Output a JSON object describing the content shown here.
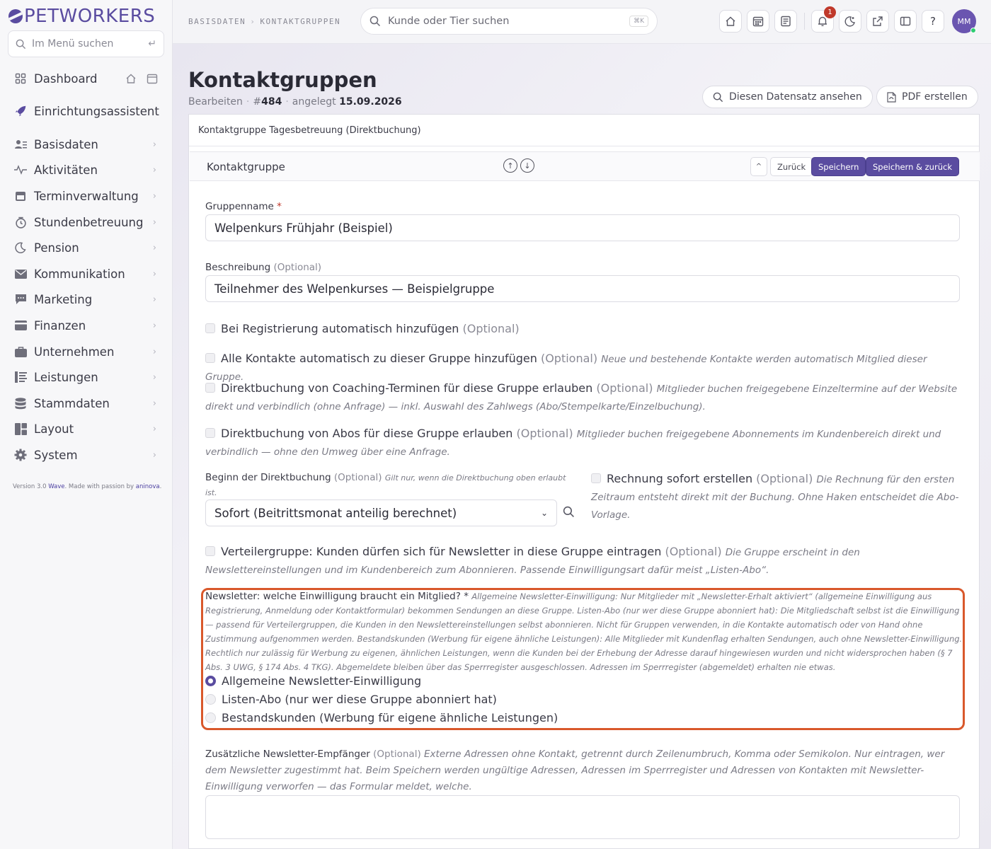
{
  "app": {
    "brand": "PETWORKERS"
  },
  "sidebar": {
    "search_placeholder": "Im Menü suchen",
    "items": [
      {
        "label": "Dashboard",
        "icon": "grid-icon"
      },
      {
        "label": "Einrichtungsassistent",
        "icon": "rocket-icon"
      },
      {
        "label": "Basisdaten",
        "icon": "contacts-icon"
      },
      {
        "label": "Aktivitäten",
        "icon": "activity-icon"
      },
      {
        "label": "Terminverwaltung",
        "icon": "calendar-icon"
      },
      {
        "label": "Stundenbetreuung",
        "icon": "clock-icon"
      },
      {
        "label": "Pension",
        "icon": "moon-icon"
      },
      {
        "label": "Kommunikation",
        "icon": "mail-icon"
      },
      {
        "label": "Marketing",
        "icon": "chat-icon"
      },
      {
        "label": "Finanzen",
        "icon": "card-icon"
      },
      {
        "label": "Unternehmen",
        "icon": "briefcase-icon"
      },
      {
        "label": "Leistungen",
        "icon": "list-icon"
      },
      {
        "label": "Stammdaten",
        "icon": "database-icon"
      },
      {
        "label": "Layout",
        "icon": "layout-icon"
      },
      {
        "label": "System",
        "icon": "gear-icon"
      }
    ],
    "version": {
      "prefix": "Version 3.0",
      "wave": "Wave",
      "middle": ". Made with passion by",
      "company": "aninova"
    }
  },
  "topbar": {
    "breadcrumb": [
      "BASISDATEN",
      "KONTAKTGRUPPEN"
    ],
    "search_placeholder": "Kunde oder Tier suchen",
    "search_shortcut": "⌘K",
    "notification_count": "1",
    "avatar_initials": "MM"
  },
  "page": {
    "title": "Kontaktgruppen",
    "mode": "Bearbeiten",
    "id_prefix": "#",
    "id": "484",
    "created_label": "angelegt",
    "created_date": "15.09.2026",
    "view_button": "Diesen Datensatz ansehen",
    "pdf_button": "PDF erstellen"
  },
  "card": {
    "title": "Kontaktgruppe Tagesbetreuung (Direktbuchung)",
    "section_title": "Kontaktgruppe",
    "btn_up": "^",
    "btn_back": "Zurück",
    "btn_save": "Speichern",
    "btn_save_back": "Speichern & zurück"
  },
  "form": {
    "optional": "(Optional)",
    "group_name_label": "Gruppenname",
    "required_mark": "*",
    "group_name_value": "Welpenkurs Frühjahr (Beispiel)",
    "description_label": "Beschreibung",
    "description_value": "Teilnehmer des Welpenkurses — Beispielgruppe",
    "cb1_label": "Bei Registrierung automatisch hinzufügen",
    "cb2_label": "Alle Kontakte automatisch zu dieser Gruppe hinzufügen",
    "cb2_hint": "Neue und bestehende Kontakte werden automatisch Mitglied dieser Gruppe.",
    "cb3_label": "Direktbuchung von Coaching-Terminen für diese Gruppe erlauben",
    "cb3_hint": "Mitglieder buchen freigegebene Einzeltermine auf der Website direkt und verbindlich (ohne Anfrage) — inkl. Auswahl des Zahlwegs (Abo/Stempelkarte/Einzelbuchung).",
    "cb4_label": "Direktbuchung von Abos für diese Gruppe erlauben",
    "cb4_hint": "Mitglieder buchen freigegebene Abonnements im Kundenbereich direkt und verbindlich — ohne den Umweg über eine Anfrage.",
    "start_label": "Beginn der Direktbuchung",
    "start_hint": "Gilt nur, wenn die Direktbuchung oben erlaubt ist.",
    "start_value": "Sofort (Beitrittsmonat anteilig berechnet)",
    "invoice_label": "Rechnung sofort erstellen",
    "invoice_hint": "Die Rechnung für den ersten Zeitraum entsteht direkt mit der Buchung. Ohne Haken entscheidet die Abo-Vorlage.",
    "cb5_label": "Verteilergruppe: Kunden dürfen sich für Newsletter in diese Gruppe eintragen",
    "cb5_hint": "Die Gruppe erscheint in den Newslettereinstellungen und im Kundenbereich zum Abonnieren. Passende Einwilligungsart dafür meist „Listen-Abo“.",
    "newsletter_label": "Newsletter: welche Einwilligung braucht ein Mitglied?",
    "newsletter_hint": "Allgemeine Newsletter-Einwilligung: Nur Mitglieder mit „Newsletter-Erhalt aktiviert“ (allgemeine Einwilligung aus Registrierung, Anmeldung oder Kontaktformular) bekommen Sendungen an diese Gruppe. Listen-Abo (nur wer diese Gruppe abonniert hat): Die Mitgliedschaft selbst ist die Einwilligung — passend für Verteilergruppen, die Kunden in den Newslettereinstellungen selbst abonnieren. Nicht für Gruppen verwenden, in die Kontakte automatisch oder von Hand ohne Zustimmung aufgenommen werden. Bestandskunden (Werbung für eigene ähnliche Leistungen): Alle Mitglieder mit Kundenflag erhalten Sendungen, auch ohne Newsletter-Einwilligung. Rechtlich nur zulässig für Werbung zu eigenen, ähnlichen Leistungen, wenn die Kunden bei der Erhebung der Adresse darauf hingewiesen wurden und nicht widersprochen haben (§ 7 Abs. 3 UWG, § 174 Abs. 4 TKG). Abgemeldete bleiben über das Sperrregister ausgeschlossen. Adressen im Sperrregister (abgemeldet) erhalten nie etwas.",
    "newsletter_options": [
      {
        "label": "Allgemeine Newsletter-Einwilligung",
        "selected": true
      },
      {
        "label": "Listen-Abo (nur wer diese Gruppe abonniert hat)",
        "selected": false
      },
      {
        "label": "Bestandskunden (Werbung für eigene ähnliche Leistungen)",
        "selected": false
      }
    ],
    "extra_label": "Zusätzliche Newsletter-Empfänger",
    "extra_hint": "Externe Adressen ohne Kontakt, getrennt durch Zeilenumbruch, Komma oder Semikolon. Nur eintragen, wer dem Newsletter zugestimmt hat. Beim Speichern werden ungültige Adressen, Adressen im Sperrregister und Adressen von Kontakten mit Newsletter-Einwilligung verworfen — das Formular meldet, welche."
  },
  "colors": {
    "accent": "#5a4ca0",
    "highlight_border": "#d9582b",
    "required": "#c0392b"
  }
}
